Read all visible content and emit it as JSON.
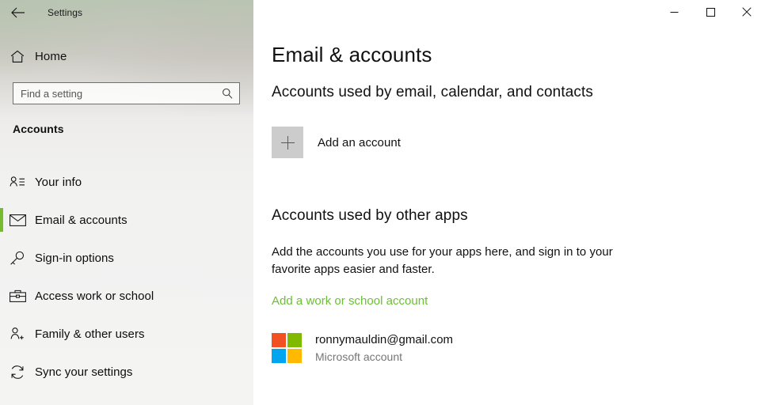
{
  "window": {
    "app_title": "Settings",
    "back_icon": "back-arrow-icon",
    "controls": {
      "minimize_label": "Minimize",
      "maximize_label": "Maximize",
      "close_label": "Close"
    }
  },
  "sidebar": {
    "home": {
      "label": "Home",
      "icon": "home-icon"
    },
    "search": {
      "value": "",
      "placeholder": "Find a setting",
      "icon": "search-icon"
    },
    "group_header": "Accounts",
    "accent_color": "#76bb2f",
    "items": [
      {
        "label": "Your info",
        "icon": "contact-info-icon",
        "selected": false
      },
      {
        "label": "Email & accounts",
        "icon": "mail-icon",
        "selected": true
      },
      {
        "label": "Sign-in options",
        "icon": "key-icon",
        "selected": false
      },
      {
        "label": "Access work or school",
        "icon": "briefcase-icon",
        "selected": false
      },
      {
        "label": "Family & other users",
        "icon": "add-user-icon",
        "selected": false
      },
      {
        "label": "Sync your settings",
        "icon": "sync-icon",
        "selected": false
      }
    ]
  },
  "main": {
    "page_title": "Email & accounts",
    "section_email": {
      "title": "Accounts used by email, calendar, and contacts",
      "add_account_label": "Add an account",
      "add_icon": "plus-icon"
    },
    "section_other_apps": {
      "title": "Accounts used by other apps",
      "description": "Add the accounts you use for your apps here, and sign in to your favorite apps easier and faster.",
      "link_label": "Add a work or school account",
      "link_color": "#6bbf35",
      "accounts": [
        {
          "name": "ronnymauldin@gmail.com",
          "type": "Microsoft account",
          "icon": "microsoft-logo-icon",
          "logo_colors": [
            "#f25022",
            "#7fba00",
            "#00a4ef",
            "#ffb900"
          ]
        }
      ]
    }
  }
}
